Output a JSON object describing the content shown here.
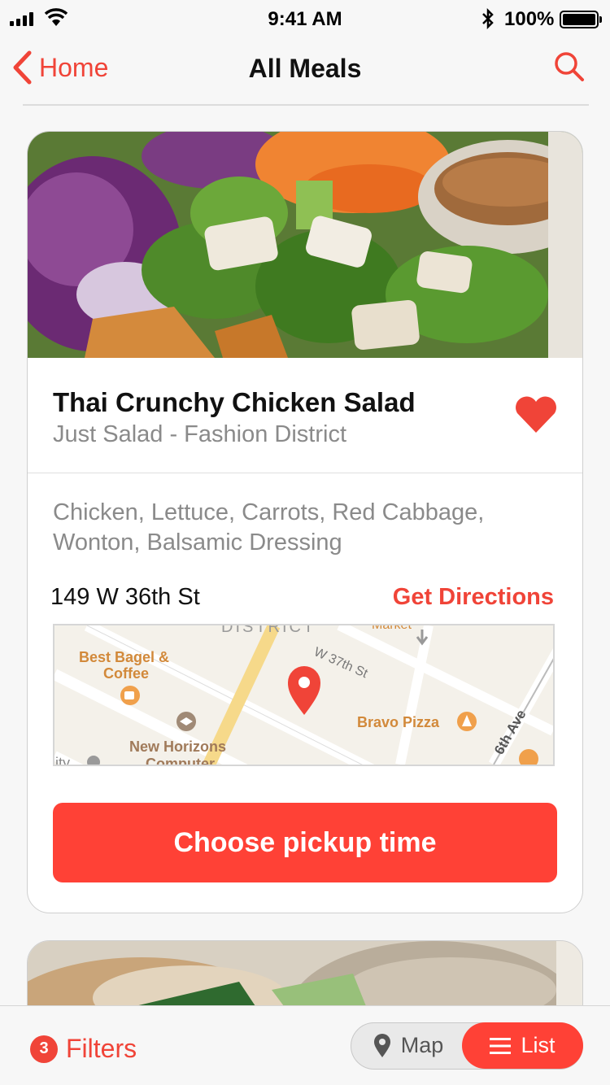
{
  "status_bar": {
    "time": "9:41 AM",
    "battery": "100%"
  },
  "nav": {
    "back_label": "Home",
    "title": "All Meals"
  },
  "meal": {
    "name": "Thai Crunchy Chicken Salad",
    "restaurant": "Just Salad - Fashion District",
    "ingredients": "Chicken, Lettuce, Carrots, Red Cabbage, Wonton, Balsamic Dressing",
    "address": "149 W 36th St",
    "directions_label": "Get Directions",
    "favorited": true,
    "cta_label": "Choose pickup time"
  },
  "map": {
    "labels": {
      "district": "DISTRICT",
      "market": "Market",
      "street": "W 37th St",
      "bagel_line1": "Best Bagel &",
      "bagel_line2": "Coffee",
      "pizza": "Bravo Pizza",
      "horizons_line1": "New Horizons",
      "horizons_line2": "Computer",
      "avenue": "6th Ave",
      "city": "City"
    }
  },
  "bottom_bar": {
    "filter_count": "3",
    "filters_label": "Filters",
    "map_label": "Map",
    "list_label": "List",
    "selected": "List"
  },
  "colors": {
    "accent": "#f04438",
    "button": "#ff4136"
  }
}
